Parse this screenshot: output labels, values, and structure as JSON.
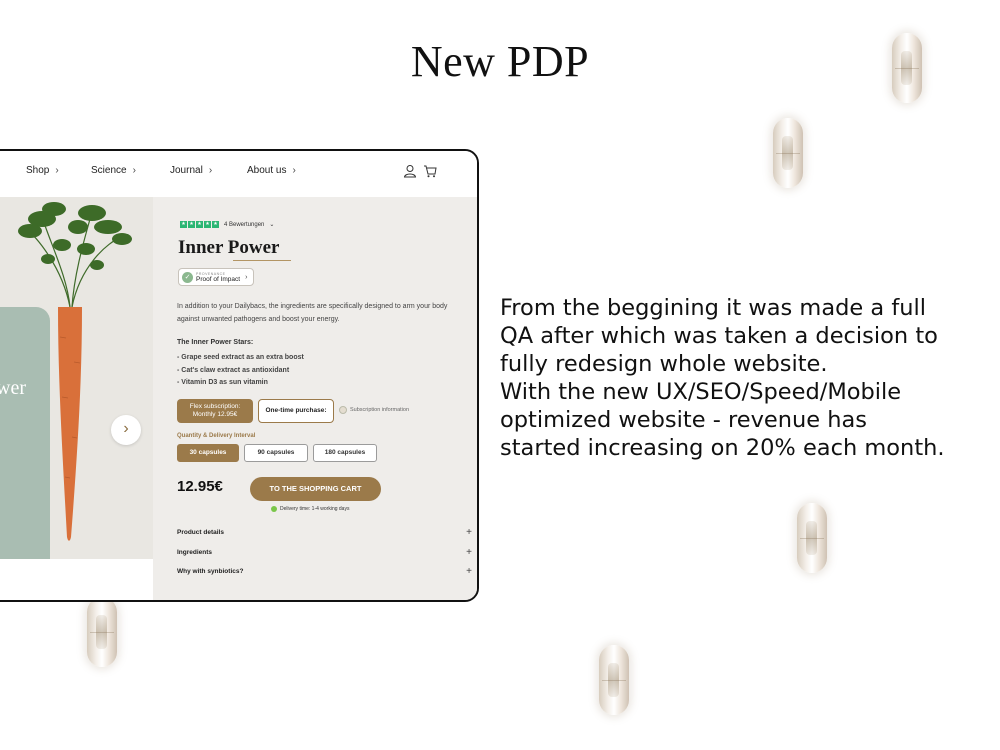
{
  "slide": {
    "title": "New PDP",
    "description_lines": [
      "From the beggining it was made a full",
      "QA after which was taken a decision to",
      "fully redesign whole website.",
      "With the new UX/SEO/Speed/Mobile",
      "optimized website - revenue has",
      "started increasing on 20% each month."
    ]
  },
  "nav": {
    "items": [
      {
        "label": "Shop"
      },
      {
        "label": "Science"
      },
      {
        "label": "Journal"
      },
      {
        "label": "About us"
      }
    ],
    "chevron": "›",
    "icons": [
      "user-icon",
      "cart-icon"
    ]
  },
  "gallery": {
    "pouch_text": "wer",
    "next_arrow": "›"
  },
  "product": {
    "reviews_label": "4 Bewertungen",
    "rating_stars": 5,
    "title": "Inner Power",
    "proof_small": "PROVENANCE",
    "proof_label": "Proof of Impact",
    "intro": "In addition to your Dailybacs, the ingredients are specifically designed to arm your body against unwanted pathogens and boost your energy.",
    "stars_heading": "The Inner Power Stars:",
    "stars_list": [
      "- Grape seed extract as an extra boost",
      "- Cat's claw extract as antioxidant",
      "- Vitamin D3 as sun vitamin"
    ],
    "subscription": {
      "flex_line1": "Flex subscription:",
      "flex_line2": "Monthly 12.95€",
      "one_time": "One-time purchase:",
      "info": "Subscription information"
    },
    "interval_label": "Quantity & Delivery Interval",
    "capsule_options": [
      "30 capsules",
      "90 capsules",
      "180 capsules"
    ],
    "price": "12.95€",
    "cart_button": "TO THE SHOPPING CART",
    "delivery": "Delivery time: 1-4 working days",
    "accordion": [
      "Product details",
      "Ingredients",
      "Why with synbiotics?"
    ]
  },
  "colors": {
    "accent": "#9b7a4a",
    "panel_bg": "#efedea",
    "rating_green": "#2bb673",
    "delivery_green": "#7ac64a"
  }
}
